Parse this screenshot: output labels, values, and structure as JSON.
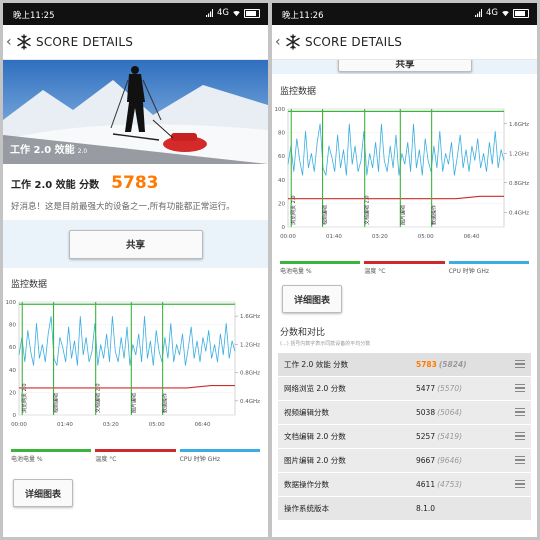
{
  "left": {
    "status_time": "晚上11:25",
    "status_net": "4G",
    "header_title": "SCORE DETAILS",
    "hero_label": "工作 2.0 效能",
    "hero_version": "2.0",
    "score_label": "工作 2.0 效能 分数",
    "score_value": "5783",
    "good_news": "好消息！这是目前最强大的设备之一,所有功能都正常运行。",
    "share_button": "共享",
    "monitor_title": "监控数据",
    "detail_button": "详细图表"
  },
  "right": {
    "status_time": "晚上11:26",
    "status_net": "4G",
    "header_title": "SCORE DETAILS",
    "partial_button": "共享",
    "monitor_title": "监控数据",
    "detail_button": "详细图表",
    "compare_title": "分数和对比",
    "compare_subtitle": "(...) 括号内数字表示同款设备的平均分数",
    "rows": [
      {
        "label": "工作 2.0 效能 分数",
        "value": "5783",
        "ref": "(5824)"
      },
      {
        "label": "网络浏览 2.0 分数",
        "value": "5477",
        "ref": "(5570)"
      },
      {
        "label": "视频编辑分数",
        "value": "5038",
        "ref": "(5064)"
      },
      {
        "label": "文档编辑 2.0 分数",
        "value": "5257",
        "ref": "(5419)"
      },
      {
        "label": "图片编辑 2.0 分数",
        "value": "9667",
        "ref": "(9646)"
      },
      {
        "label": "数据操作分数",
        "value": "4611",
        "ref": "(4753)"
      },
      {
        "label": "操作系统版本",
        "value": "8.1.0",
        "ref": ""
      }
    ]
  },
  "chart_data": {
    "type": "line",
    "y_left_ticks": [
      "100",
      "80",
      "60",
      "40",
      "20",
      "0"
    ],
    "y_right_ticks": [
      "1.6GHz",
      "1.2GHz",
      "0.8GHz",
      "0.4GHz"
    ],
    "x_ticks": [
      "00:00",
      "01:40",
      "03:20",
      "05:00",
      "06:40"
    ],
    "markers": [
      "浏览网页 2.0",
      "视频编辑",
      "文档编辑 2.0",
      "图片编辑",
      "数据操作"
    ],
    "legend": [
      {
        "name": "电池电量 %",
        "color": "#3cb43c"
      },
      {
        "name": "温度 °C",
        "color": "#cc2b2b"
      },
      {
        "name": "CPU 时钟 GHz",
        "color": "#3aaee0"
      }
    ],
    "series": [
      {
        "name": "电池电量 %",
        "values": [
          98,
          98
        ]
      },
      {
        "name": "温度 °C",
        "values": [
          24,
          24,
          24,
          24,
          24,
          24,
          24,
          24,
          26,
          26
        ]
      },
      {
        "name": "CPU 时钟 GHz",
        "values": [
          1.05,
          1.3,
          0.95,
          1.4,
          1.1,
          0.9,
          1.5,
          1.0,
          1.2,
          0.95,
          1.35,
          1.6,
          1.0,
          0.9,
          1.3,
          1.15,
          0.95,
          1.45,
          1.0,
          1.25,
          0.9,
          1.6,
          1.05,
          1.3,
          0.95,
          1.1,
          1.5,
          0.9,
          1.2,
          1.0,
          1.35,
          0.95,
          1.6,
          1.1,
          0.95,
          1.3,
          1.0,
          1.45,
          0.9,
          1.2,
          1.05,
          1.35,
          0.95,
          1.6,
          1.0,
          1.25,
          0.9,
          1.4,
          1.1,
          0.95,
          1.3,
          1.0,
          1.5,
          0.95,
          1.2,
          1.05,
          1.35,
          0.9,
          1.15,
          1.45,
          1.0,
          1.25,
          0.95,
          1.3,
          1.1,
          1.4,
          1.0,
          1.2,
          0.95,
          1.35,
          1.05,
          1.5,
          1.0,
          1.25,
          1.1
        ]
      }
    ]
  }
}
